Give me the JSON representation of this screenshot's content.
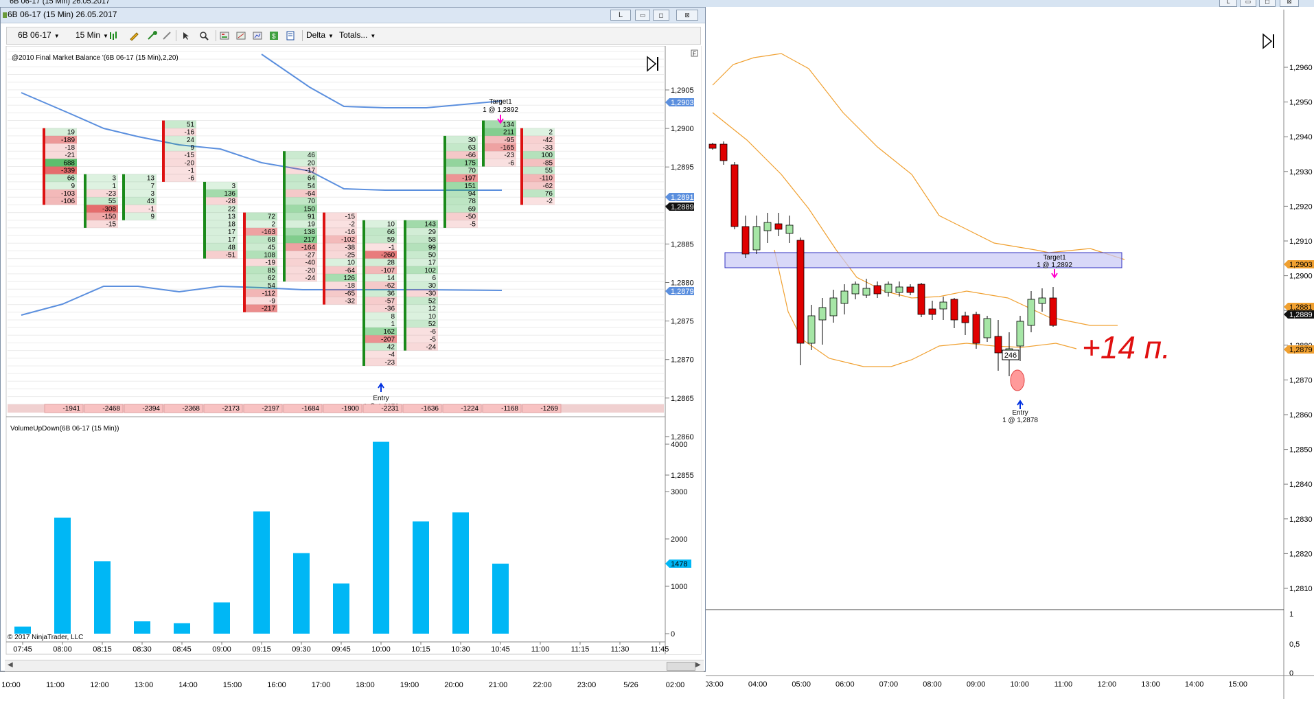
{
  "background_window": {
    "title": "6B 06-17 (15 Min)  26.05.2017",
    "right_chart": {
      "price_axis_ticks": [
        "1,2960",
        "1,2950",
        "1,2940",
        "1,2930",
        "1,2920",
        "1,2910",
        "1,2900",
        "1,2890",
        "1,2880",
        "1,2870",
        "1,2860",
        "1,2850",
        "1,2840",
        "1,2830",
        "1,2820",
        "1,2810"
      ],
      "price_labels": {
        "target": "1,2903",
        "upper": "1,2881",
        "last": "1,2889",
        "entry": "1,2879"
      },
      "lower_panel_ticks": [
        "1",
        "0,5",
        "0"
      ],
      "time_ticks": [
        "03:00",
        "04:00",
        "05:00",
        "06:00",
        "07:00",
        "08:00",
        "09:00",
        "10:00",
        "11:00",
        "12:00",
        "13:00",
        "14:00",
        "15:00"
      ],
      "target_label": "Target1",
      "target_detail": "1 @ 1,2892",
      "entry_label": "Entry",
      "entry_detail": "1 @ 1,2878",
      "box_value": "246",
      "annotation": "+14 п."
    },
    "bottom_time_ticks": [
      "10:00",
      "11:00",
      "12:00",
      "13:00",
      "14:00",
      "15:00",
      "16:00",
      "17:00",
      "18:00",
      "19:00",
      "20:00",
      "21:00",
      "22:00",
      "23:00",
      "5/26",
      "02:00"
    ]
  },
  "popup_window": {
    "title": "6B 06-17 (15 Min)  26.05.2017",
    "window_buttons": {
      "link": "L",
      "min": "▭",
      "max": "◻",
      "close": "⊠"
    },
    "toolbar": {
      "instrument": "6B 06-17",
      "interval": "15 Min",
      "delta": "Delta",
      "totals": "Totals..."
    },
    "indicator_label": "@2010 Final Market Balance '(6B 06-17 (15 Min),2,20)",
    "price_axis_ticks": [
      "1,2905",
      "1,2900",
      "1,2895",
      "1,2890",
      "1,2885",
      "1,2880",
      "1,2875",
      "1,2870",
      "1,2865",
      "1,2860",
      "1,2855"
    ],
    "price_labels": {
      "upper": "1,2903",
      "band": "1,2891",
      "last": "1,2889",
      "lower": "1,2879"
    },
    "target_label": "Target1",
    "target_detail": "1 @ 1,2892",
    "entry_label": "Entry",
    "entry_detail": "1 @ 1,2878",
    "totals_row": [
      "-1941",
      "-2468",
      "-2394",
      "-2368",
      "-2173",
      "-2197",
      "-1684",
      "-1900",
      "-2231",
      "-1636",
      "-1224",
      "-1168",
      "-1269"
    ],
    "volume_panel_label": "VolumeUpDown(6B 06-17 (15 Min))",
    "volume_axis_ticks": [
      "4000",
      "3000",
      "2000",
      "1000",
      "0"
    ],
    "volume_last_label": "1478",
    "copyright": "© 2017 NinjaTrader, LLC",
    "time_ticks": [
      "07:45",
      "08:00",
      "08:15",
      "08:30",
      "08:45",
      "09:00",
      "09:15",
      "09:30",
      "09:45",
      "10:00",
      "10:15",
      "10:30",
      "10:45",
      "11:00",
      "11:15",
      "11:30",
      "11:45"
    ],
    "footprint_columns": [
      {
        "cells": [
          "19",
          "-189",
          "-18",
          "-21",
          "688",
          "-339",
          "66",
          "9",
          "-103",
          "-106"
        ]
      },
      {
        "cells": [
          "3",
          "1",
          "-23",
          "55",
          "-308",
          "-150",
          "-15"
        ]
      },
      {
        "cells": [
          "13",
          "7",
          "3",
          "43",
          "-1",
          "9"
        ]
      },
      {
        "cells": [
          "51",
          "-16",
          "24",
          "9",
          "-15",
          "-20",
          "-1",
          "-6"
        ]
      },
      {
        "cells": [
          "3",
          "136",
          "-28",
          "22",
          "13",
          "18",
          "17",
          "17",
          "48",
          "-51"
        ]
      },
      {
        "cells": [
          "72",
          "2",
          "-163",
          "68",
          "45",
          "108",
          "-19",
          "85",
          "62",
          "54",
          "-112",
          "-9",
          "-217"
        ]
      },
      {
        "cells": [
          "46",
          "20",
          "-17",
          "64",
          "54",
          "-64",
          "70",
          "150",
          "91",
          "19",
          "138",
          "217",
          "-164",
          "-27",
          "-40",
          "-20",
          "-24"
        ]
      },
      {
        "cells": [
          "-15",
          "-2",
          "-16",
          "-102",
          "-38",
          "-25",
          "10",
          "-64",
          "126",
          "-18",
          "-65",
          "-32"
        ]
      },
      {
        "cells": [
          "10",
          "66",
          "59",
          "-1",
          "-260",
          "28",
          "-107",
          "14",
          "-62",
          "36",
          "-57",
          "-36",
          "8",
          "1",
          "162",
          "-207",
          "42",
          "-4",
          "-23"
        ]
      },
      {
        "cells": [
          "143",
          "29",
          "58",
          "99",
          "50",
          "17",
          "102",
          "6",
          "30",
          "-30",
          "52",
          "12",
          "10",
          "52",
          "-6",
          "-5",
          "-24"
        ]
      },
      {
        "cells": [
          "30",
          "63",
          "-66",
          "175",
          "70",
          "-197",
          "151",
          "94",
          "78",
          "69",
          "-50",
          "-5"
        ]
      },
      {
        "cells": [
          "134",
          "211",
          "-95",
          "-165",
          "-23",
          "-6"
        ]
      },
      {
        "cells": [
          "2",
          "-42",
          "-33",
          "100",
          "-85",
          "55",
          "-110",
          "-62",
          "76",
          "-2"
        ]
      }
    ],
    "volume_bars": [
      {
        "time": "07:45",
        "value": 150
      },
      {
        "time": "08:00",
        "value": 2450
      },
      {
        "time": "08:15",
        "value": 1530
      },
      {
        "time": "08:30",
        "value": 260
      },
      {
        "time": "08:45",
        "value": 220
      },
      {
        "time": "09:00",
        "value": 660
      },
      {
        "time": "09:15",
        "value": 2580
      },
      {
        "time": "09:30",
        "value": 1700
      },
      {
        "time": "09:45",
        "value": 1060
      },
      {
        "time": "10:00",
        "value": 4050
      },
      {
        "time": "10:15",
        "value": 2370
      },
      {
        "time": "10:30",
        "value": 2560
      },
      {
        "time": "10:45",
        "value": 1478
      }
    ]
  },
  "colors": {
    "volume_bar": "#00b7f5",
    "band_line": "#5b8fde",
    "candle_up": "#a6e6a6",
    "candle_down": "#e00000",
    "bollinger": "#f0a030",
    "target_zone": "#c8c8f5",
    "annotation": "#e01010",
    "positive_cell": "#d9f5d9",
    "negative_cell": "#f8d0d0"
  }
}
